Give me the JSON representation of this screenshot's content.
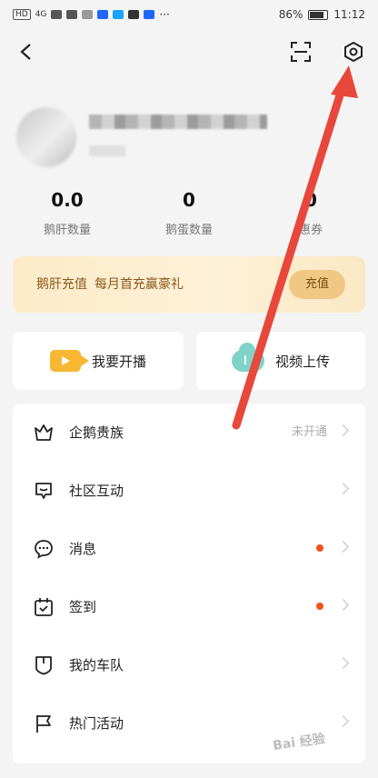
{
  "status_bar": {
    "left_text": "HD",
    "network": "4G",
    "battery": "86%",
    "time": "11:12"
  },
  "stats": [
    {
      "value": "0.0",
      "label": "鹅肝数量"
    },
    {
      "value": "0",
      "label": "鹅蛋数量"
    },
    {
      "value": "0",
      "label": "惠券"
    }
  ],
  "recharge": {
    "title": "鹅肝充值",
    "subtitle": "每月首充赢豪礼",
    "button": "充值"
  },
  "actions": [
    {
      "label": "我要开播",
      "icon": "video-camera-icon"
    },
    {
      "label": "视频上传",
      "icon": "cloud-upload-icon"
    }
  ],
  "menu": [
    {
      "label": "企鹅贵族",
      "status": "未开通",
      "dot": false,
      "icon": "crown-icon"
    },
    {
      "label": "社区互动",
      "status": "",
      "dot": false,
      "icon": "community-icon"
    },
    {
      "label": "消息",
      "status": "",
      "dot": true,
      "icon": "message-icon"
    },
    {
      "label": "签到",
      "status": "",
      "dot": true,
      "icon": "calendar-check-icon"
    },
    {
      "label": "我的车队",
      "status": "",
      "dot": false,
      "icon": "shield-icon"
    },
    {
      "label": "热门活动",
      "status": "",
      "dot": false,
      "icon": "flag-icon"
    }
  ],
  "watermark": "Bai 经验",
  "colors": {
    "accent_red": "#f2511b",
    "gold_banner": "#fdebc9",
    "annotation_arrow": "#e8473c"
  }
}
